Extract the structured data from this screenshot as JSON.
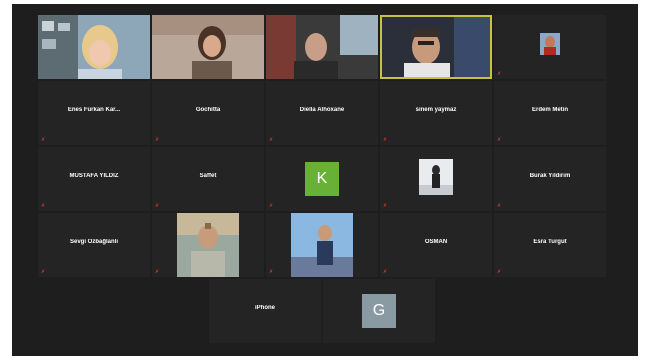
{
  "tiles": [
    {
      "name": "",
      "video": true
    },
    {
      "name": "",
      "video": true
    },
    {
      "name": "",
      "video": true
    },
    {
      "name": "",
      "video": true,
      "active": true
    },
    {
      "name": "",
      "photo": true
    },
    {
      "name": "Enes Furkan Kar..."
    },
    {
      "name": "Gochitta"
    },
    {
      "name": "Diella Alhoxane"
    },
    {
      "name": "sinem yaymaz"
    },
    {
      "name": "Erdem Metin"
    },
    {
      "name": "MUSTAFA YILDIZ"
    },
    {
      "name": "Saffet"
    },
    {
      "name": "",
      "avatar_letter": "K"
    },
    {
      "name": "",
      "photo": true
    },
    {
      "name": "Burak Yıldırım"
    },
    {
      "name": "Sevgi Özbağlanlı"
    },
    {
      "name": "",
      "photo": true
    },
    {
      "name": "",
      "photo": true
    },
    {
      "name": "OSMAN"
    },
    {
      "name": "Esra Turgut"
    },
    {
      "name": "iPhone"
    },
    {
      "name": "",
      "avatar_letter": "G"
    }
  ],
  "colors": {
    "frame_bg": "#1e1e1e",
    "tile_bg": "#242424",
    "active_border": "#c9c241",
    "muted_icon": "#e0362c",
    "avatar_k": "#67b236",
    "avatar_g": "#8a9aa3"
  }
}
